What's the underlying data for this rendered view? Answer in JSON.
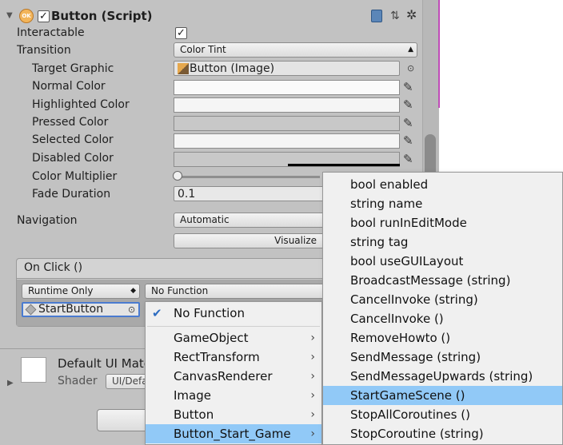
{
  "component": {
    "title": "Button (Script)",
    "enabled": true
  },
  "props": {
    "interactable_label": "Interactable",
    "transition_label": "Transition",
    "transition_value": "Color Tint",
    "target_graphic_label": "Target Graphic",
    "target_graphic_value": "Button (Image)",
    "normal_color_label": "Normal Color",
    "highlighted_color_label": "Highlighted Color",
    "pressed_color_label": "Pressed Color",
    "selected_color_label": "Selected Color",
    "disabled_color_label": "Disabled Color",
    "color_multiplier_label": "Color Multiplier",
    "fade_duration_label": "Fade Duration",
    "fade_duration_value": "0.1",
    "navigation_label": "Navigation",
    "navigation_value": "Automatic",
    "visualize_label": "Visualize"
  },
  "onclick": {
    "title": "On Click ()",
    "runtime_value": "Runtime Only",
    "function_value": "No Function",
    "object_value": "StartButton"
  },
  "material": {
    "name": "Default UI Mate",
    "shader_label": "Shader",
    "shader_value": "UI/Defa"
  },
  "menu_main": {
    "items": [
      {
        "label": "No Function",
        "checked": true
      },
      {
        "label": "GameObject"
      },
      {
        "label": "RectTransform"
      },
      {
        "label": "CanvasRenderer"
      },
      {
        "label": "Image"
      },
      {
        "label": "Button"
      },
      {
        "label": "Button_Start_Game"
      }
    ]
  },
  "menu_sub": {
    "items": [
      {
        "label": "bool enabled"
      },
      {
        "label": "string name"
      },
      {
        "label": "bool runInEditMode"
      },
      {
        "label": "string tag"
      },
      {
        "label": "bool useGUILayout"
      },
      {
        "label": "BroadcastMessage (string)"
      },
      {
        "label": "CancelInvoke (string)"
      },
      {
        "label": "CancelInvoke ()"
      },
      {
        "label": "RemoveHowto ()"
      },
      {
        "label": "SendMessage (string)"
      },
      {
        "label": "SendMessageUpwards (string)"
      },
      {
        "label": "StartGameScene ()"
      },
      {
        "label": "StopAllCoroutines ()"
      },
      {
        "label": "StopCoroutine (string)"
      }
    ]
  },
  "colors": {
    "highlight": "#91c9f7",
    "accent_pink": "#c04db8"
  }
}
